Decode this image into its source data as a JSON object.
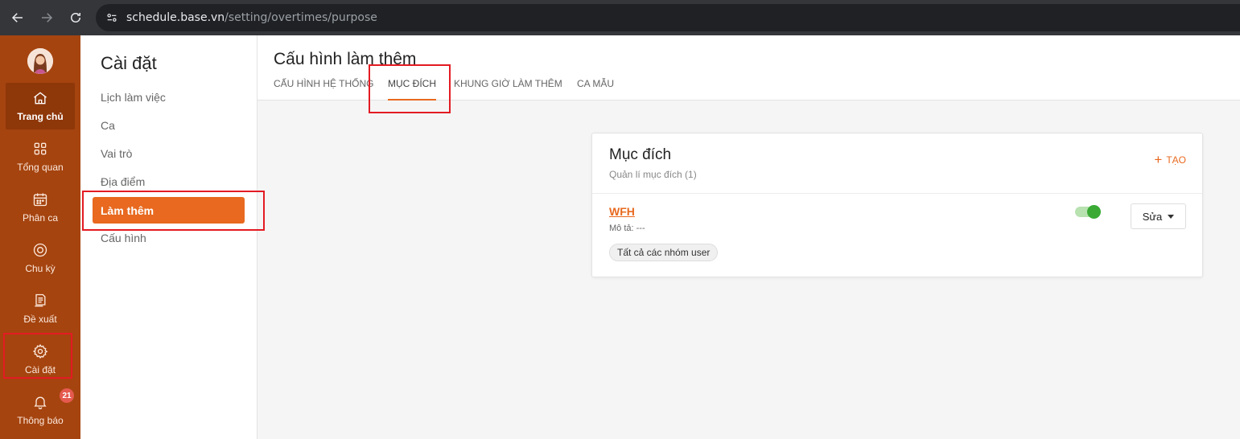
{
  "browser": {
    "url_host": "schedule.base.vn",
    "url_path": "/setting/overtimes/purpose"
  },
  "app_sidebar": {
    "items": [
      {
        "label": "Trang chủ",
        "icon": "home-icon",
        "active": true
      },
      {
        "label": "Tổng quan",
        "icon": "grid-icon"
      },
      {
        "label": "Phân ca",
        "icon": "calendar-icon"
      },
      {
        "label": "Chu kỳ",
        "icon": "cycle-icon"
      },
      {
        "label": "Đề xuất",
        "icon": "document-icon"
      },
      {
        "label": "Cài đặt",
        "icon": "gear-icon"
      },
      {
        "label": "Thông báo",
        "icon": "bell-icon",
        "badge": "21"
      }
    ]
  },
  "settings": {
    "title": "Cài đặt",
    "items": [
      {
        "label": "Lịch làm việc"
      },
      {
        "label": "Ca"
      },
      {
        "label": "Vai trò"
      },
      {
        "label": "Địa điểm"
      },
      {
        "label": "Làm thêm",
        "active": true
      },
      {
        "label": "Cấu hình"
      }
    ]
  },
  "header": {
    "title": "Cấu hình làm thêm",
    "tabs": [
      {
        "label": "CẤU HÌNH HỆ THỐNG"
      },
      {
        "label": "MỤC ĐÍCH",
        "active": true
      },
      {
        "label": "KHUNG GIỜ LÀM THÊM"
      },
      {
        "label": "CA MẪU"
      }
    ]
  },
  "card": {
    "title": "Mục đích",
    "subtitle": "Quản lí mục đích (1)",
    "create_label": "TẠO",
    "item": {
      "name": "WFH",
      "description": "Mô tả: ---",
      "tag": "Tất cả các nhóm user",
      "enabled": true,
      "edit_label": "Sửa"
    }
  },
  "colors": {
    "accent": "#e8691f",
    "sidebar": "#a5440f",
    "highlight": "#e31b23",
    "toggle_on": "#3aaa35"
  }
}
